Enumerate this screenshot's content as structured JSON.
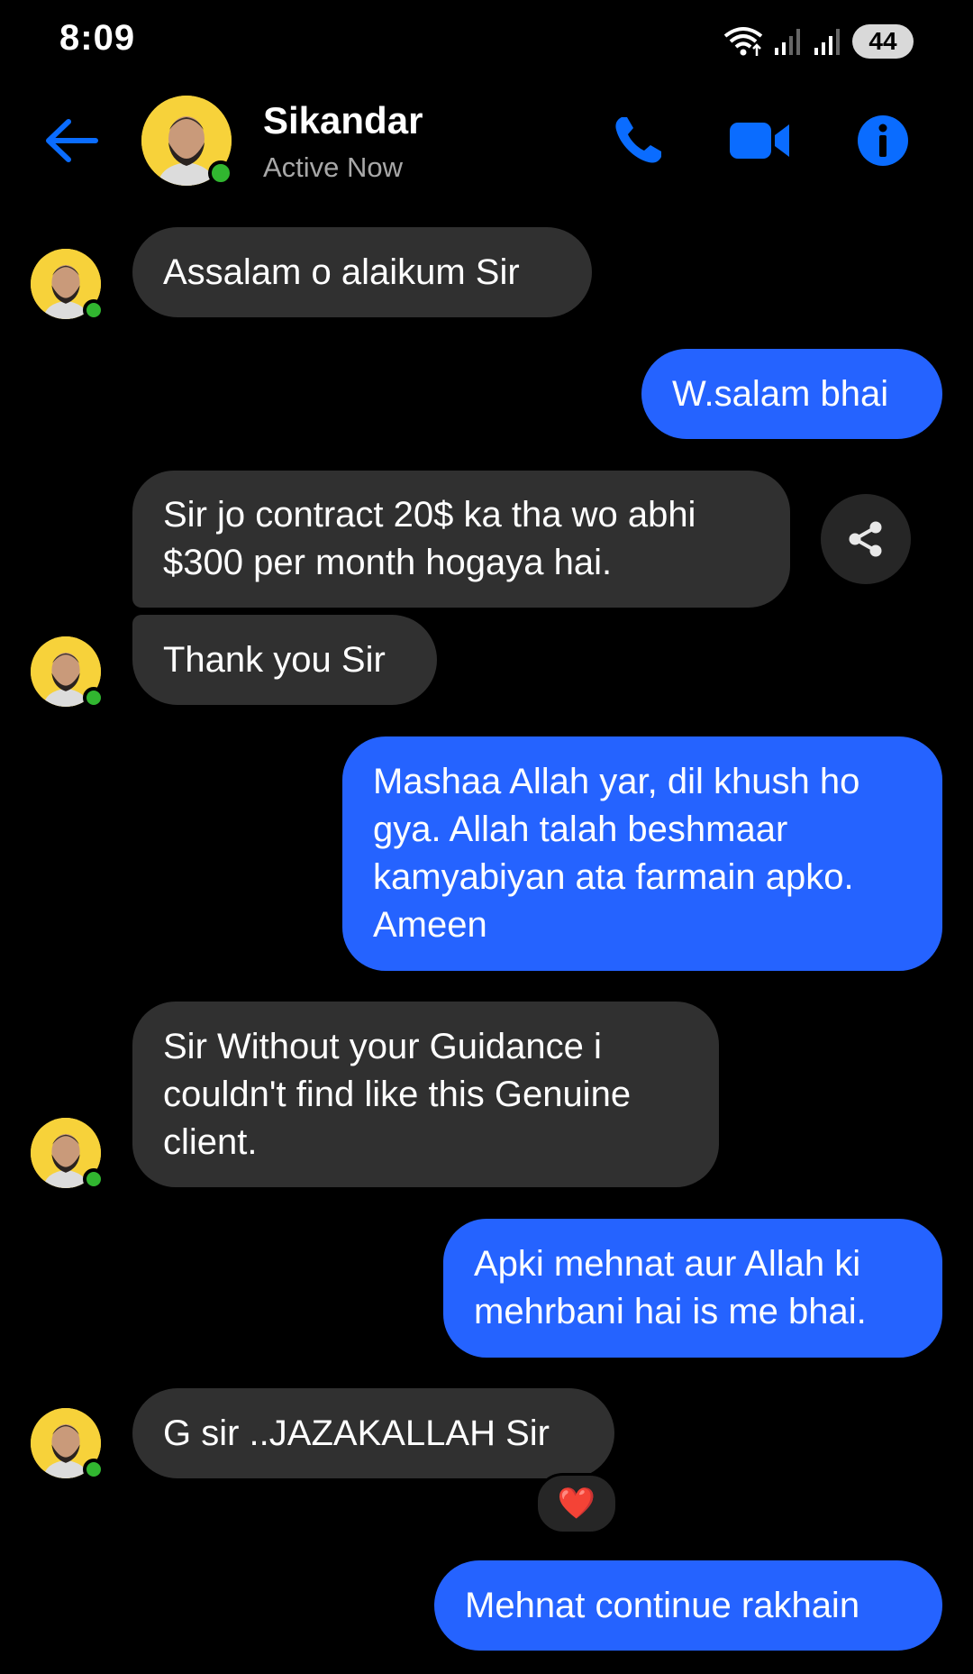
{
  "status_bar": {
    "time": "8:09",
    "battery": "44",
    "icons": [
      "wifi-icon",
      "signal-icon",
      "signal-icon",
      "battery-icon"
    ]
  },
  "header": {
    "contact_name": "Sikandar",
    "contact_status": "Active Now",
    "icons": [
      "back-arrow-icon",
      "phone-icon",
      "video-camera-icon",
      "info-icon"
    ]
  },
  "colors": {
    "background": "#000000",
    "incoming_bubble": "#303030",
    "outgoing_bubble": "#2563ff",
    "accent": "#0a6cff",
    "online": "#31b630"
  },
  "messages": [
    {
      "direction": "incoming",
      "text": "Assalam o alaikum Sir"
    },
    {
      "direction": "outgoing",
      "text": "W.salam bhai"
    },
    {
      "direction": "incoming",
      "text": "Sir jo contract 20$ ka tha wo abhi $300 per month hogaya hai."
    },
    {
      "direction": "incoming",
      "text": "Thank you Sir"
    },
    {
      "direction": "outgoing",
      "text": "Mashaa Allah yar, dil khush ho gya. Allah talah beshmaar kamyabiyan ata farmain apko. Ameen"
    },
    {
      "direction": "incoming",
      "text": "Sir Without your Guidance i couldn't find like this Genuine client."
    },
    {
      "direction": "outgoing",
      "text": "Apki mehnat aur Allah ki mehrbani hai is me bhai."
    },
    {
      "direction": "incoming",
      "text": "G sir ..JAZAKALLAH Sir",
      "reaction": "❤️"
    },
    {
      "direction": "outgoing",
      "text": "Mehnat continue rakhain"
    }
  ]
}
